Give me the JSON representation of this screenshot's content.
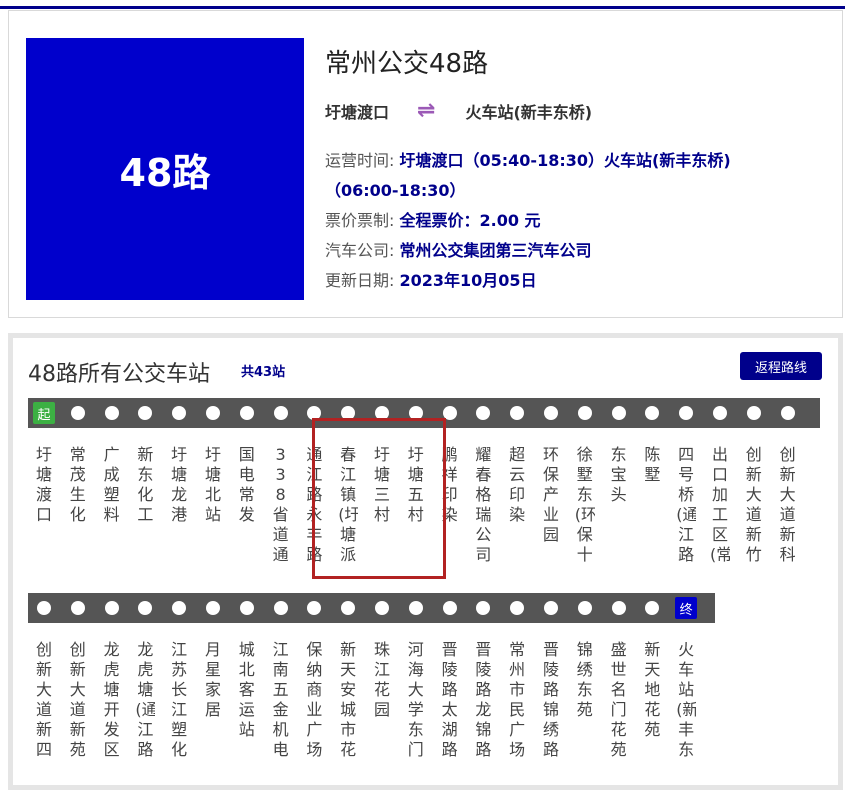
{
  "route": {
    "badge": "48路",
    "title": "常州公交48路",
    "from": "圩塘渡口",
    "to": "火车站(新丰东桥)",
    "swap_icon": "⇌",
    "info": [
      {
        "label": "运营时间:",
        "value": "圩塘渡口（05:40-18:30）火车站(新丰东桥)"
      },
      {
        "label": "",
        "value": "（06:00-18:30）"
      },
      {
        "label": "票价票制:",
        "value": "全程票价：2.00 元"
      },
      {
        "label": "汽车公司:",
        "value": "常州公交集团第三汽车公司"
      },
      {
        "label": "更新日期:",
        "value": "2023年10月05日"
      }
    ]
  },
  "stations_panel": {
    "title": "48路所有公交车站",
    "count": "共43站",
    "return_label": "返程路线",
    "start_tag": "起",
    "end_tag": "终",
    "row1": [
      "圩塘渡口",
      "常茂生化",
      "广成塑料",
      "新东化工",
      "圩塘龙港",
      "圩塘北站",
      "国电常发",
      "338省道通江路",
      "通江路永丰路",
      "春江镇(圩塘派",
      "圩塘三村",
      "圩塘五村",
      "鹏祥印染",
      "耀春格瑞公司",
      "超云印染",
      "环保产业园",
      "徐墅东(环保十",
      "东宝头",
      "陈墅",
      "四号桥(通江路",
      "出口加工区(常",
      "创新大道新竹",
      "创新大道新科"
    ],
    "row2": [
      "创新大道新四",
      "创新大道新苑",
      "龙虎塘开发区",
      "龙虎塘(通江路",
      "江苏长江塑化",
      "月星家居",
      "城北客运站",
      "江南五金机电",
      "保纳商业广场",
      "新天安城市花",
      "珠江花园",
      "河海大学东门",
      "晋陵路太湖路",
      "晋陵路龙锦路",
      "常州市民广场",
      "晋陵路锦绣路",
      "锦绣东苑",
      "盛世名门花苑",
      "新天地花苑",
      "火车站(新丰东"
    ]
  },
  "colors": {
    "accent": "#00008b",
    "badge_bg": "#0000cc",
    "track": "#555555",
    "start_tag": "#3cb043",
    "highlight": "#b22222"
  }
}
